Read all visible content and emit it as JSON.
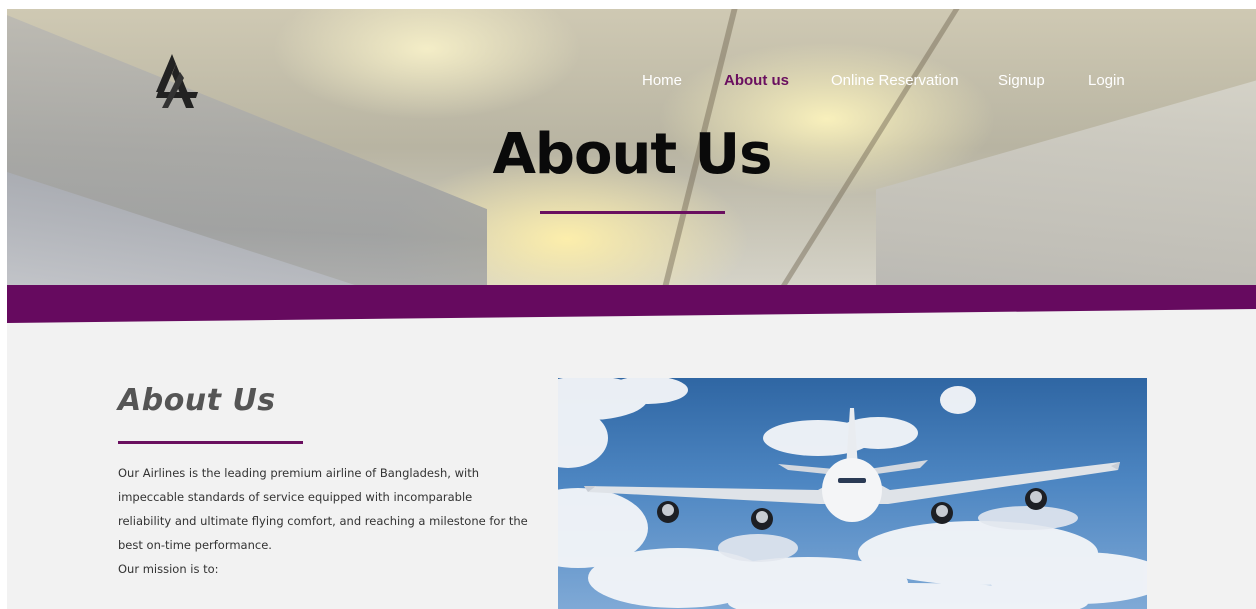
{
  "brand": {
    "logo": "la-logo-icon"
  },
  "nav": {
    "items": [
      {
        "label": "Home",
        "active": false
      },
      {
        "label": "About us",
        "active": true
      },
      {
        "label": "Online Reservation",
        "active": false
      },
      {
        "label": "Signup",
        "active": false
      },
      {
        "label": "Login",
        "active": false
      }
    ]
  },
  "hero": {
    "title": "About Us"
  },
  "about": {
    "heading": "About Us",
    "paragraph": "Our Airlines is the leading premium airline of Bangladesh, with impeccable standards of service equipped with incomparable reliability and ultimate flying comfort, and reaching a milestone for the best on-time performance.",
    "mission_label": "Our mission is to:"
  },
  "colors": {
    "accent": "#6a0f5f",
    "page_background": "#f2f2f2",
    "nav_text": "#ffffff"
  }
}
